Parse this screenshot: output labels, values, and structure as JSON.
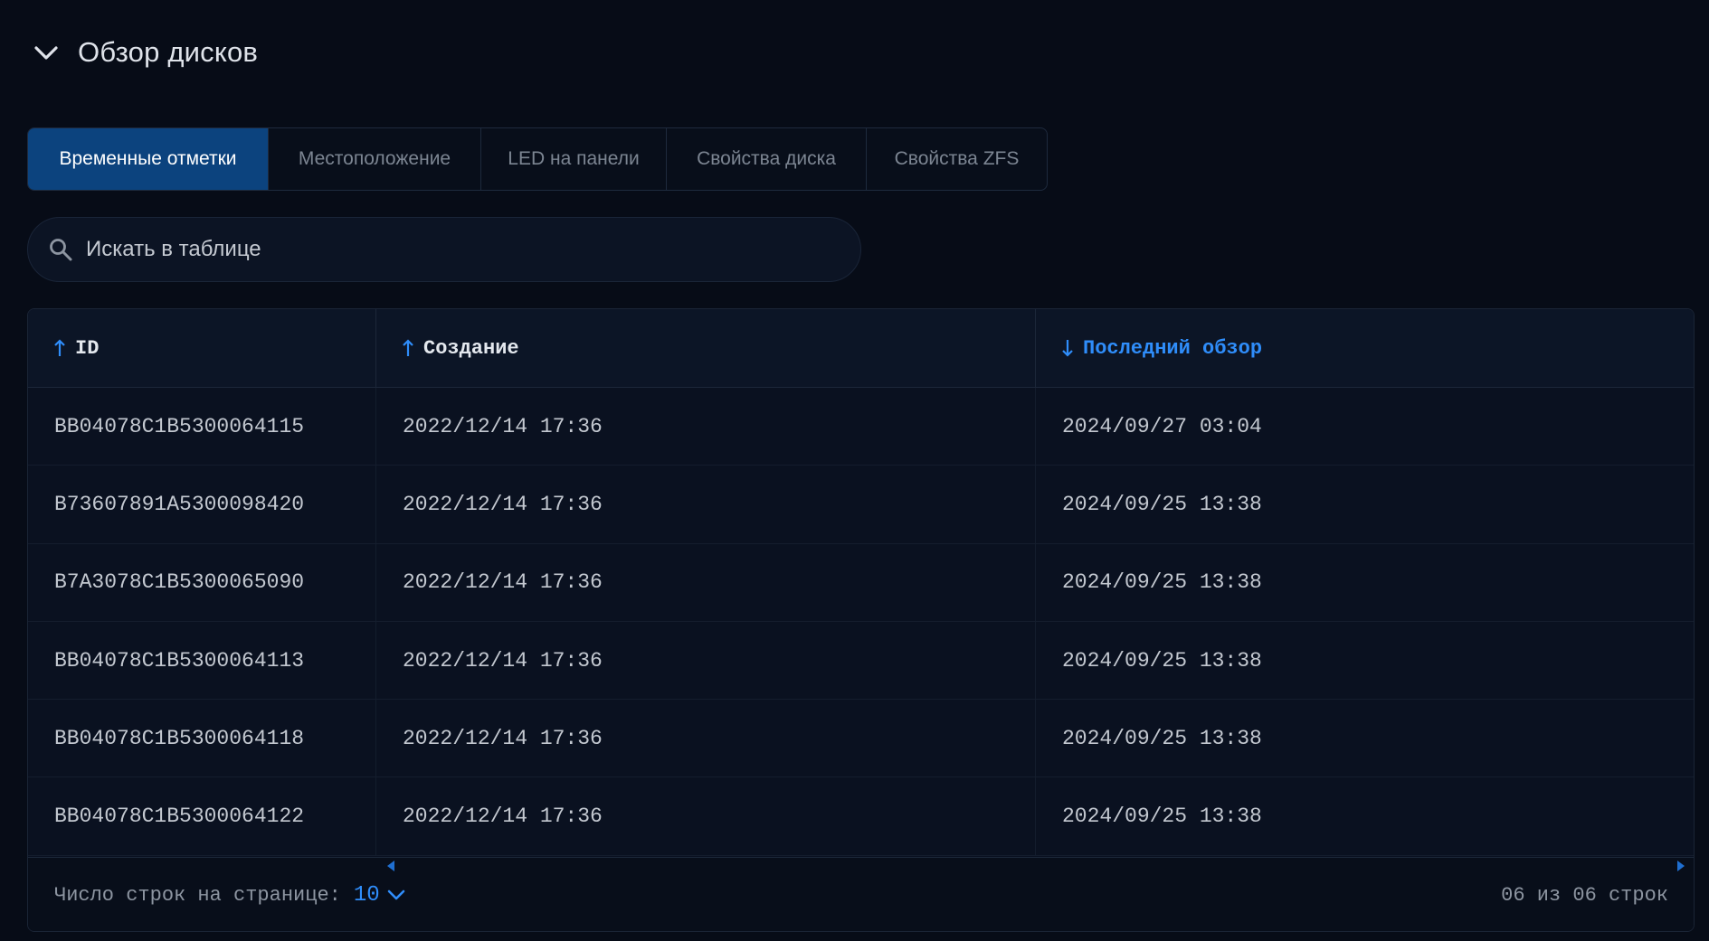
{
  "section": {
    "title": "Обзор дисков",
    "toggle_icon": "chevron-down-icon"
  },
  "tabs": [
    {
      "label": "Временные отметки",
      "active": true
    },
    {
      "label": "Местоположение",
      "active": false
    },
    {
      "label": "LED на панели",
      "active": false
    },
    {
      "label": "Свойства диска",
      "active": false
    },
    {
      "label": "Свойства ZFS",
      "active": false
    }
  ],
  "search": {
    "placeholder": "Искать в таблице",
    "value": "",
    "icon": "search-icon"
  },
  "table": {
    "columns": [
      {
        "label": "ID",
        "sort": "asc",
        "sorted": false
      },
      {
        "label": "Создание",
        "sort": "asc",
        "sorted": false
      },
      {
        "label": "Последний обзор",
        "sort": "desc",
        "sorted": true
      }
    ],
    "rows": [
      [
        "BB04078C1B5300064115",
        "2022/12/14 17:36",
        "2024/09/27 03:04"
      ],
      [
        "B73607891A5300098420",
        "2022/12/14 17:36",
        "2024/09/25 13:38"
      ],
      [
        "B7A3078C1B5300065090",
        "2022/12/14 17:36",
        "2024/09/25 13:38"
      ],
      [
        "BB04078C1B5300064113",
        "2022/12/14 17:36",
        "2024/09/25 13:38"
      ],
      [
        "BB04078C1B5300064118",
        "2022/12/14 17:36",
        "2024/09/25 13:38"
      ],
      [
        "BB04078C1B5300064122",
        "2022/12/14 17:36",
        "2024/09/25 13:38"
      ]
    ]
  },
  "footer": {
    "rows_per_page_label": "Число строк на странице:",
    "rows_per_page_value": "10",
    "row_count": "06 из 06 строк"
  },
  "colors": {
    "background": "#070c17",
    "accent": "#2f8dfa",
    "active_tab": "#0c437e"
  }
}
